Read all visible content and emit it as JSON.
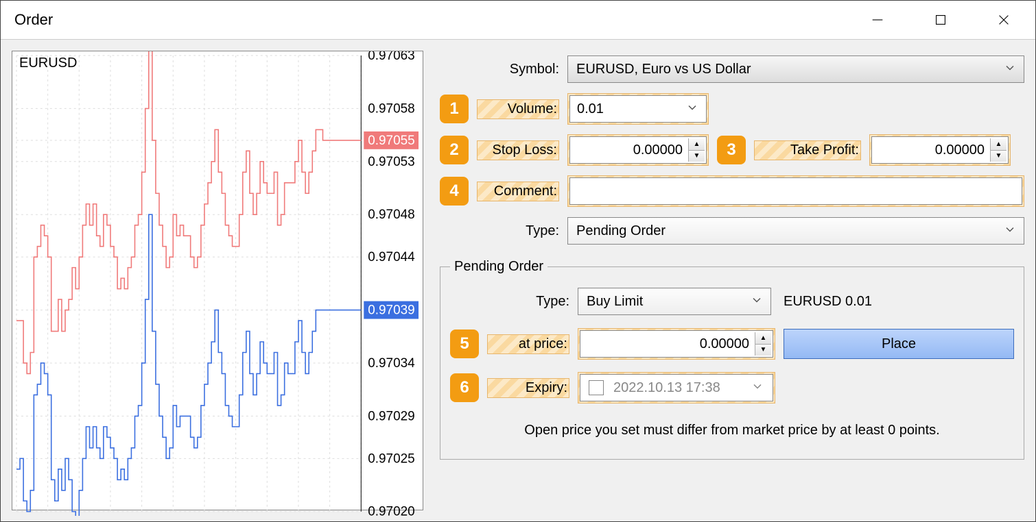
{
  "window": {
    "title": "Order"
  },
  "chart": {
    "symbol": "EURUSD"
  },
  "axis_labels": [
    "0.97063",
    "0.97058",
    "0.97055",
    "0.97053",
    "0.97048",
    "0.97044",
    "0.97039",
    "0.97034",
    "0.97029",
    "0.97025",
    "0.97020"
  ],
  "price_ask": "0.97055",
  "price_bid": "0.97039",
  "form": {
    "symbol_label": "Symbol:",
    "symbol_value": "EURUSD, Euro vs US Dollar",
    "volume_label": "Volume:",
    "volume_value": "0.01",
    "stoploss_label": "Stop Loss:",
    "stoploss_value": "0.00000",
    "takeprofit_label": "Take Profit:",
    "takeprofit_value": "0.00000",
    "comment_label": "Comment:",
    "type_label": "Type:",
    "type_value": "Pending Order"
  },
  "callouts": {
    "c1": "1",
    "c2": "2",
    "c3": "3",
    "c4": "4",
    "c5": "5",
    "c6": "6"
  },
  "pending": {
    "legend": "Pending Order",
    "type_label": "Type:",
    "type_value": "Buy Limit",
    "summary": "EURUSD 0.01",
    "atprice_label": "at price:",
    "atprice_value": "0.00000",
    "place_label": "Place",
    "expiry_label": "Expiry:",
    "expiry_value": "2022.10.13 17:38",
    "note": "Open price you set must differ from market price by at least 0 points."
  },
  "chart_data": {
    "type": "line",
    "title": "EURUSD",
    "ylim": [
      0.9702,
      0.97063
    ],
    "yticks": [
      0.97063,
      0.97058,
      0.97055,
      0.97053,
      0.97048,
      0.97044,
      0.97039,
      0.97034,
      0.97029,
      0.97025,
      0.9702
    ],
    "series": [
      {
        "name": "ask",
        "color": "#f07a7a",
        "current": 0.97055,
        "values": [
          0.97038,
          0.97038,
          0.97034,
          0.97033,
          0.97035,
          0.97044,
          0.97045,
          0.97047,
          0.97046,
          0.97044,
          0.97037,
          0.97037,
          0.9704,
          0.97037,
          0.97039,
          0.9704,
          0.97043,
          0.97041,
          0.97044,
          0.97047,
          0.97049,
          0.97047,
          0.97049,
          0.97046,
          0.97045,
          0.97048,
          0.97047,
          0.97045,
          0.97044,
          0.97041,
          0.97042,
          0.97041,
          0.97043,
          0.97044,
          0.97047,
          0.97048,
          0.97052,
          0.97058,
          0.97065,
          0.97055,
          0.9705,
          0.97047,
          0.97045,
          0.97043,
          0.97044,
          0.97048,
          0.97046,
          0.97047,
          0.97046,
          0.97046,
          0.97044,
          0.97043,
          0.97044,
          0.97047,
          0.97049,
          0.97051,
          0.97053,
          0.97056,
          0.97052,
          0.9705,
          0.97047,
          0.97046,
          0.97045,
          0.97045,
          0.97048,
          0.97052,
          0.97054,
          0.9705,
          0.97048,
          0.9705,
          0.97053,
          0.97051,
          0.9705,
          0.9705,
          0.97052,
          0.97047,
          0.97048,
          0.97051,
          0.97051,
          0.97051,
          0.97053,
          0.97055,
          0.97052,
          0.9705,
          0.97052,
          0.97054,
          0.97056,
          0.97056,
          0.97055,
          0.97055,
          0.97055,
          0.97055,
          0.97055,
          0.97055,
          0.97055,
          0.97055,
          0.97055,
          0.97055,
          0.97055,
          0.97055
        ]
      },
      {
        "name": "bid",
        "color": "#3b6fe0",
        "current": 0.97039,
        "values": [
          0.97024,
          0.97025,
          0.97021,
          0.9702,
          0.97022,
          0.97031,
          0.97032,
          0.97034,
          0.97033,
          0.97031,
          0.97023,
          0.97021,
          0.97024,
          0.97022,
          0.97025,
          0.97023,
          0.9702,
          0.97019,
          0.97022,
          0.97025,
          0.97028,
          0.97026,
          0.97028,
          0.97026,
          0.97025,
          0.97028,
          0.97027,
          0.97026,
          0.97025,
          0.97023,
          0.97024,
          0.97023,
          0.97025,
          0.97026,
          0.97029,
          0.9703,
          0.97034,
          0.9704,
          0.97048,
          0.97037,
          0.97032,
          0.97029,
          0.97027,
          0.97025,
          0.97026,
          0.9703,
          0.97028,
          0.97029,
          0.97029,
          0.97029,
          0.97027,
          0.97026,
          0.97027,
          0.9703,
          0.97032,
          0.97034,
          0.97036,
          0.97039,
          0.97035,
          0.97033,
          0.9703,
          0.97029,
          0.97028,
          0.97028,
          0.97031,
          0.97035,
          0.97037,
          0.97033,
          0.97031,
          0.97033,
          0.97036,
          0.97034,
          0.97033,
          0.97033,
          0.97035,
          0.9703,
          0.97031,
          0.97034,
          0.97033,
          0.97033,
          0.97036,
          0.97038,
          0.97035,
          0.97033,
          0.97035,
          0.97037,
          0.97039,
          0.97039,
          0.97039,
          0.97039,
          0.97039,
          0.97039,
          0.97039,
          0.97039,
          0.97039,
          0.97039,
          0.97039,
          0.97039,
          0.97039,
          0.97039
        ]
      }
    ]
  }
}
